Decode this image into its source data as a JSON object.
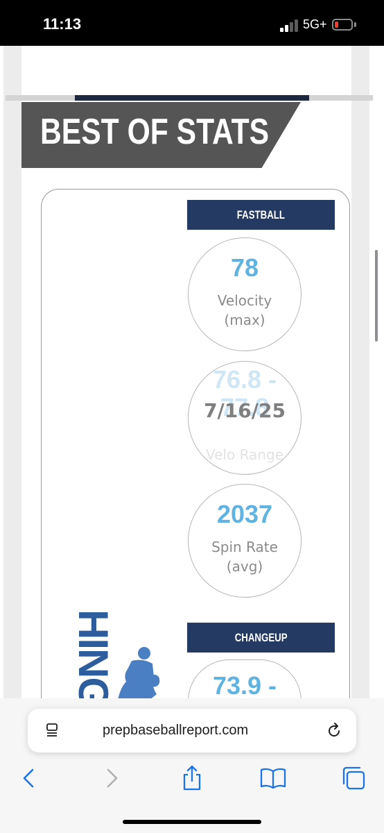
{
  "status_bar": {
    "time": "11:13",
    "network": "5G+"
  },
  "page": {
    "section_title": "BEST OF STATS",
    "fastball": {
      "header": "FASTBALL",
      "velocity": {
        "value": "78",
        "label_line1": "Velocity",
        "label_line2": "(max)"
      },
      "velo_range": {
        "value": "76.8 -",
        "value_line2": "77.8",
        "label": "Velo Range",
        "date_overlay": "7/16/25"
      },
      "spin_rate": {
        "value": "2037",
        "label_line1": "Spin Rate",
        "label_line2": "(avg)"
      }
    },
    "changeup": {
      "header": "CHANGEUP",
      "velo_range": {
        "value": "73.9 -"
      }
    },
    "vertical_word": "HING"
  },
  "browser": {
    "url": "prepbaseballreport.com"
  },
  "colors": {
    "banner": "#555555",
    "header": "#243a63",
    "stat_value": "#5fb3e0",
    "silhouette": "#4a7fc4"
  },
  "icons": [
    "page-menu-icon",
    "reload-icon",
    "back-icon",
    "forward-icon",
    "share-icon",
    "bookmarks-icon",
    "tabs-icon"
  ]
}
